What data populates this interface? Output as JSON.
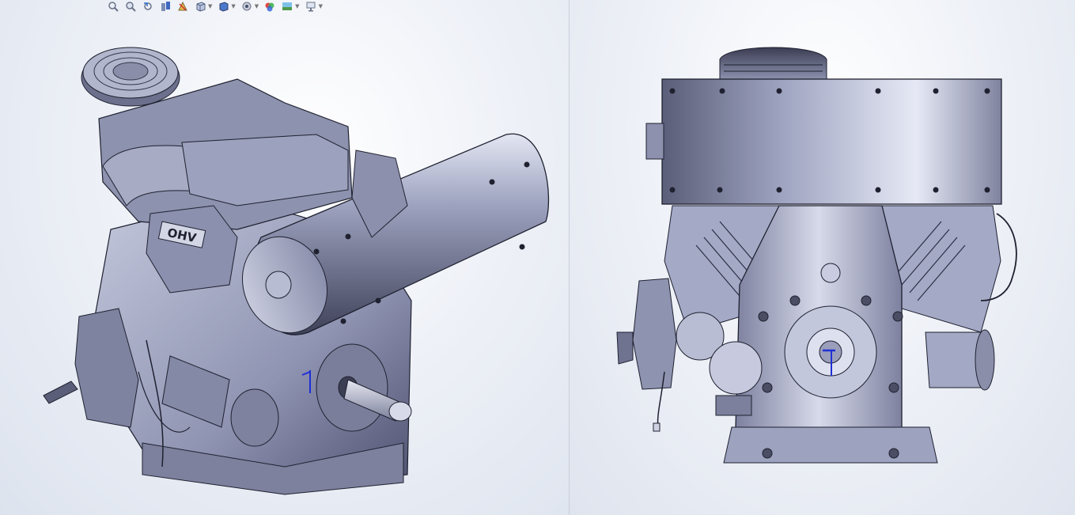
{
  "app": {
    "viewports": [
      {
        "id": "left",
        "view": "isometric",
        "model": "engine-assembly"
      },
      {
        "id": "right",
        "view": "front",
        "model": "engine-assembly"
      }
    ]
  },
  "toolbar": {
    "tools": [
      {
        "icon": "zoom-to-fit-icon",
        "dropdown": false
      },
      {
        "icon": "zoom-to-area-icon",
        "dropdown": false
      },
      {
        "icon": "previous-view-icon",
        "dropdown": false
      },
      {
        "icon": "section-view-icon",
        "dropdown": false
      },
      {
        "icon": "dynamic-annotation-icon",
        "dropdown": false
      },
      {
        "icon": "view-orientation-icon",
        "dropdown": true
      },
      {
        "icon": "display-style-icon",
        "dropdown": true
      },
      {
        "icon": "hide-show-items-icon",
        "dropdown": true
      },
      {
        "icon": "edit-appearance-icon",
        "dropdown": false
      },
      {
        "icon": "apply-scene-icon",
        "dropdown": true
      },
      {
        "icon": "view-settings-icon",
        "dropdown": true
      }
    ]
  },
  "engine": {
    "valve_cover_label": "OHV",
    "colors": {
      "body": "#9aa0bc",
      "shadow": "#3e4156",
      "highlight": "#dde1f0",
      "triad": "#1f2fd6"
    }
  }
}
